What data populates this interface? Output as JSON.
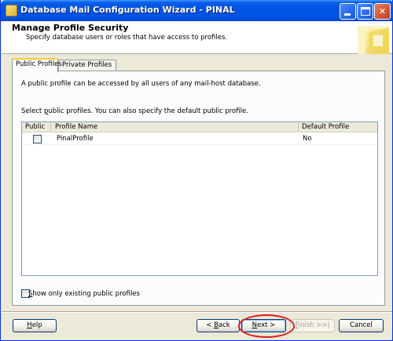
{
  "window": {
    "title": "Database Mail Configuration Wizard - PINAL"
  },
  "header": {
    "title": "Manage Profile Security",
    "subtitle": "Specify database users or roles that have access to profiles."
  },
  "tabs": [
    {
      "label": "Public Profiles",
      "active": true
    },
    {
      "label": "Private Profiles",
      "active": false
    }
  ],
  "page": {
    "description": "A public profile can be accessed by all users of any mail-host database.",
    "instruction_prefix": "Select ",
    "instruction_underlined": "p",
    "instruction_suffix": "ublic profiles. You can also specify the default public profile."
  },
  "grid": {
    "columns": [
      "Public",
      "Profile Name",
      "Default Profile"
    ],
    "rows": [
      {
        "public": false,
        "profile_name": "PinalProfile",
        "default_profile": "No"
      }
    ]
  },
  "show_existing": {
    "checked": false,
    "label_underlined": "S",
    "label_rest": "how only existing public profiles"
  },
  "buttons": {
    "help": {
      "underlined": "H",
      "rest": "elp"
    },
    "back": {
      "prefix": "< ",
      "underlined": "B",
      "rest": "ack"
    },
    "next": {
      "underlined": "N",
      "rest": "ext >"
    },
    "finish": {
      "underlined": "F",
      "rest": "inish >>|"
    },
    "cancel": {
      "label": "Cancel"
    }
  },
  "colors": {
    "titlebar": "#0054e3",
    "highlight_ellipse": "#e01b1b",
    "active_tab_accent": "#ffc83c"
  }
}
